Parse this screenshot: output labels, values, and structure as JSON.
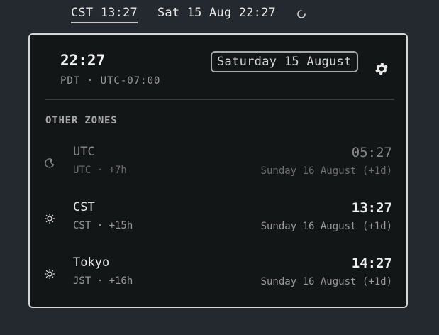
{
  "topbar": {
    "clock": "CST 13:27",
    "date": "Sat 15 Aug 22:27",
    "icon": "loading-spinner-icon"
  },
  "main": {
    "time": "22:27",
    "zone": "PDT · UTC-07:00",
    "date": "Saturday 15 August",
    "settings_icon": "gear-icon"
  },
  "section_title": "OTHER ZONES",
  "zones": [
    {
      "name": "UTC",
      "offset": "UTC · +7h",
      "time": "05:27",
      "date": "Sunday 16 August (+1d)",
      "icon": "moon-icon",
      "dim": true
    },
    {
      "name": "CST",
      "offset": "CST · +15h",
      "time": "13:27",
      "date": "Sunday 16 August (+1d)",
      "icon": "sun-icon",
      "dim": false
    },
    {
      "name": "Tokyo",
      "offset": "JST · +16h",
      "time": "14:27",
      "date": "Sunday 16 August (+1d)",
      "icon": "sun-icon",
      "dim": false
    }
  ],
  "colors": {
    "background": "#24292f",
    "popup": "#131617",
    "border": "#d6d6d6"
  }
}
